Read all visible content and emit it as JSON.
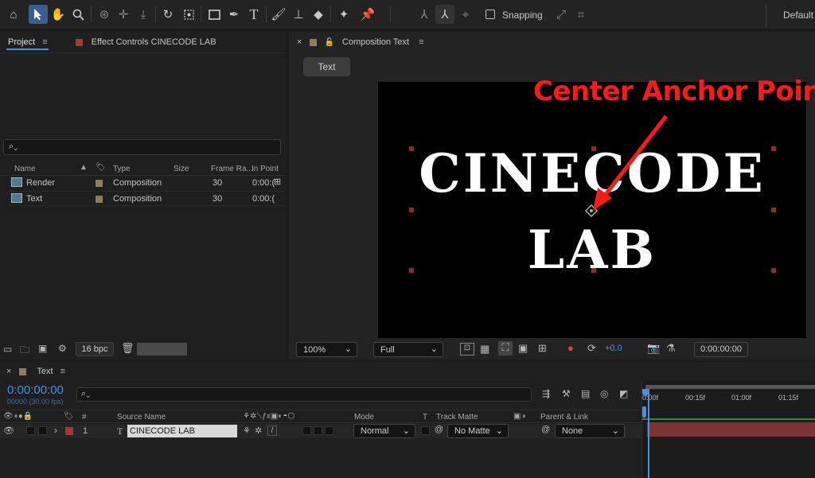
{
  "toolbar": {
    "icons": [
      "home-icon",
      "selection-icon",
      "hand-icon",
      "zoom-icon",
      "orbit-camera-icon",
      "pan-camera-icon",
      "dolly-camera-icon",
      "rotate-icon",
      "pan-behind-icon",
      "rectangle-icon",
      "pen-icon",
      "type-icon",
      "brush-icon",
      "clone-stamp-icon",
      "eraser-icon",
      "roto-brush-icon",
      "puppet-pin-icon"
    ],
    "snapping_label": "Snapping",
    "workspace_label": "Default"
  },
  "project_panel": {
    "tab_project": "Project",
    "tab_effect_controls": "Effect Controls CINECODE LAB",
    "search_placeholder": "",
    "columns": {
      "name": "Name",
      "type": "Type",
      "size": "Size",
      "frame_rate": "Frame Ra...",
      "in_point": "In Point"
    },
    "items": [
      {
        "name": "Render",
        "type": "Composition",
        "frame_rate": "30",
        "in_point": "0:00:("
      },
      {
        "name": "Text",
        "type": "Composition",
        "frame_rate": "30",
        "in_point": "0:00:("
      }
    ],
    "bpc_label": "16 bpc"
  },
  "composition_panel": {
    "tab_label": "Composition Text",
    "flowchart_chip": "Text",
    "canvas_line1": "CINECODE",
    "canvas_line2": "LAB",
    "annotation": "Center Anchor Point",
    "annotation_color": "#ff1a1a",
    "zoom_value": "100%",
    "resolution_value": "Full",
    "exposure_value": "+0.0",
    "timecode": "0:00:00:00"
  },
  "timeline": {
    "tab_label": "Text",
    "current_time": "0:00:00:00",
    "frame_info": "00000 (30.00 fps)",
    "search_placeholder": "",
    "columns": {
      "hash": "#",
      "source_name": "Source Name",
      "mode": "Mode",
      "t": "T",
      "track_matte": "Track Matte",
      "parent_link": "Parent & Link"
    },
    "layer": {
      "index": "1",
      "type_glyph": "T",
      "name": "CINECODE LAB",
      "mode": "Normal",
      "track_matte": "No Matte",
      "parent": "None"
    },
    "ruler_marks": [
      "0:00f",
      "00:15f",
      "01:00f",
      "01:15f"
    ],
    "colors": {
      "accent_blue": "#4a90e2",
      "layer_bar": "#8b3a3a",
      "work_area_green": "#2f8b3a"
    }
  }
}
